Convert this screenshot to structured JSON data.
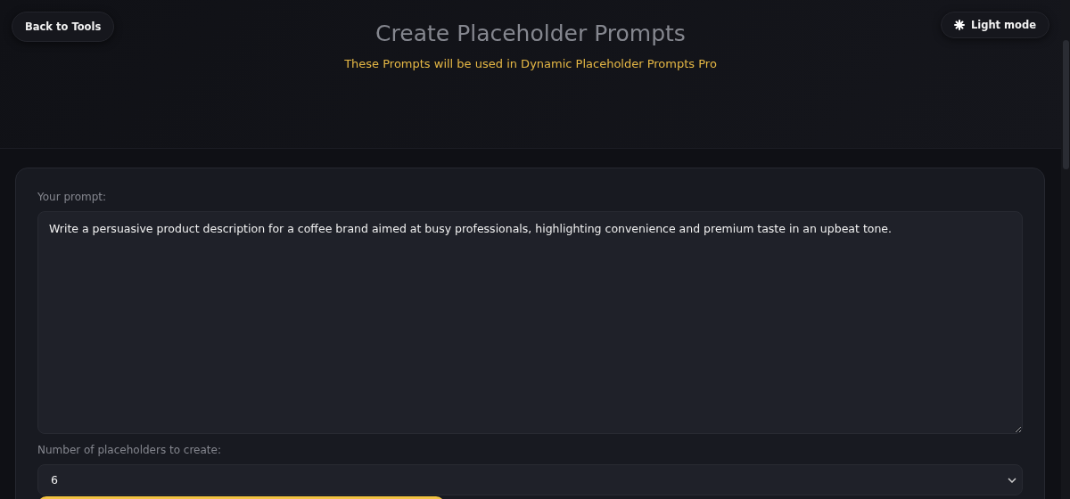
{
  "header": {
    "back_button": "Back to Tools",
    "title": "Create Placeholder Prompts",
    "subtitle": "These Prompts will be used in Dynamic Placeholder Prompts Pro",
    "theme_button": "Light mode"
  },
  "form": {
    "prompt_label": "Your prompt:",
    "prompt_value": "Write a persuasive product description for a coffee brand aimed at busy professionals, highlighting convenience and premium taste in an upbeat tone.",
    "count_label": "Number of placeholders to create:",
    "count_value": "6"
  }
}
